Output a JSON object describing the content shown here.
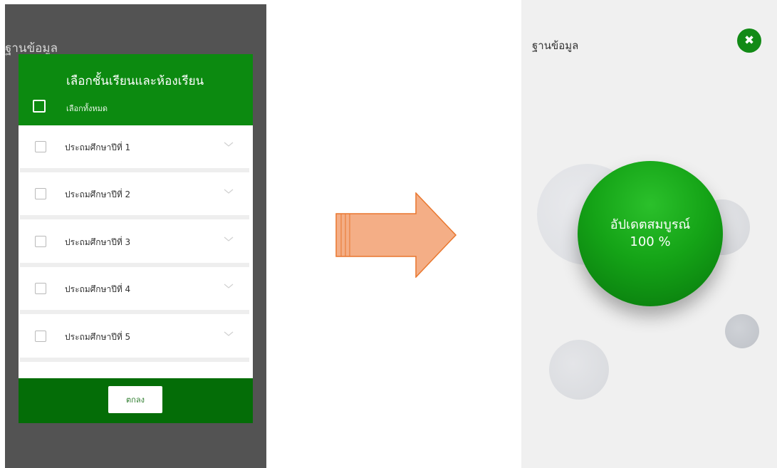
{
  "left_screen": {
    "background_title": "ฐานข้อมูล",
    "dialog": {
      "title": "เลือกชั้นเรียนและห้องเรียน",
      "select_all_label": "เลือกทั้งหมด",
      "items": [
        {
          "label": "ประถมศึกษาปีที่ 1"
        },
        {
          "label": "ประถมศึกษาปีที่ 2"
        },
        {
          "label": "ประถมศึกษาปีที่ 3"
        },
        {
          "label": "ประถมศึกษาปีที่ 4"
        },
        {
          "label": "ประถมศึกษาปีที่ 5"
        }
      ],
      "ok_label": "ตกลง"
    }
  },
  "right_screen": {
    "title": "ฐานข้อมูล",
    "status_text": "อัปเดตสมบูรณ์",
    "progress_text": "100 %"
  },
  "icons": {
    "close": "close-icon",
    "checkbox": "checkbox-icon",
    "chevron": "chevron-down-icon",
    "transition": "arrow-right-icon"
  },
  "colors": {
    "brand_green": "#0c8a10",
    "dark_green": "#046d07",
    "arrow_fill": "#f4ae86",
    "arrow_stroke": "#e9772e",
    "overlay": "#535353"
  }
}
